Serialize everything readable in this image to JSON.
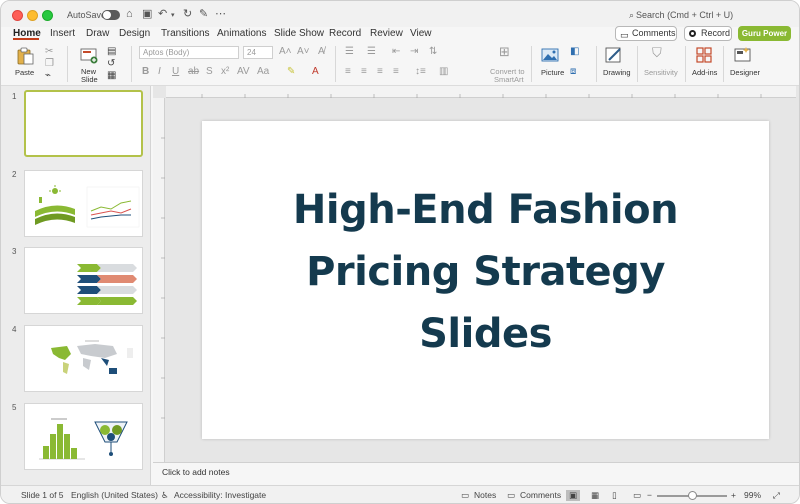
{
  "titlebar": {
    "autosave_label": "AutoSave",
    "search_placeholder": "Search (Cmd + Ctrl + U)"
  },
  "tabs": [
    "Home",
    "Insert",
    "Draw",
    "Design",
    "Transitions",
    "Animations",
    "Slide Show",
    "Record",
    "Review",
    "View"
  ],
  "header_buttons": {
    "comments": "Comments",
    "record": "Record",
    "guru": "Guru Power"
  },
  "ribbon": {
    "paste": "Paste",
    "new_slide_line1": "New",
    "new_slide_line2": "Slide",
    "font_name": "Aptos (Body)",
    "font_size": "24",
    "convert_line1": "Convert to",
    "convert_line2": "SmartArt",
    "picture": "Picture",
    "drawing": "Drawing",
    "sensitivity": "Sensitivity",
    "addins": "Add-ins",
    "designer": "Designer"
  },
  "slides_panel": {
    "numbers": [
      "1",
      "2",
      "3",
      "4",
      "5"
    ]
  },
  "slide": {
    "title_line1": "High-End Fashion",
    "title_line2": "Pricing Strategy",
    "title_line3": "Slides"
  },
  "notes": {
    "placeholder": "Click to add notes"
  },
  "status": {
    "slide_counter": "Slide 1 of 5",
    "language": "English (United States)",
    "accessibility": "Accessibility: Investigate",
    "notes": "Notes",
    "comments": "Comments",
    "zoom": "99%"
  },
  "colors": {
    "accent_tab": "#c43e1c",
    "guru_button": "#8ab933",
    "title_text": "#143a4e",
    "thumb_selected": "#b3c24a"
  }
}
